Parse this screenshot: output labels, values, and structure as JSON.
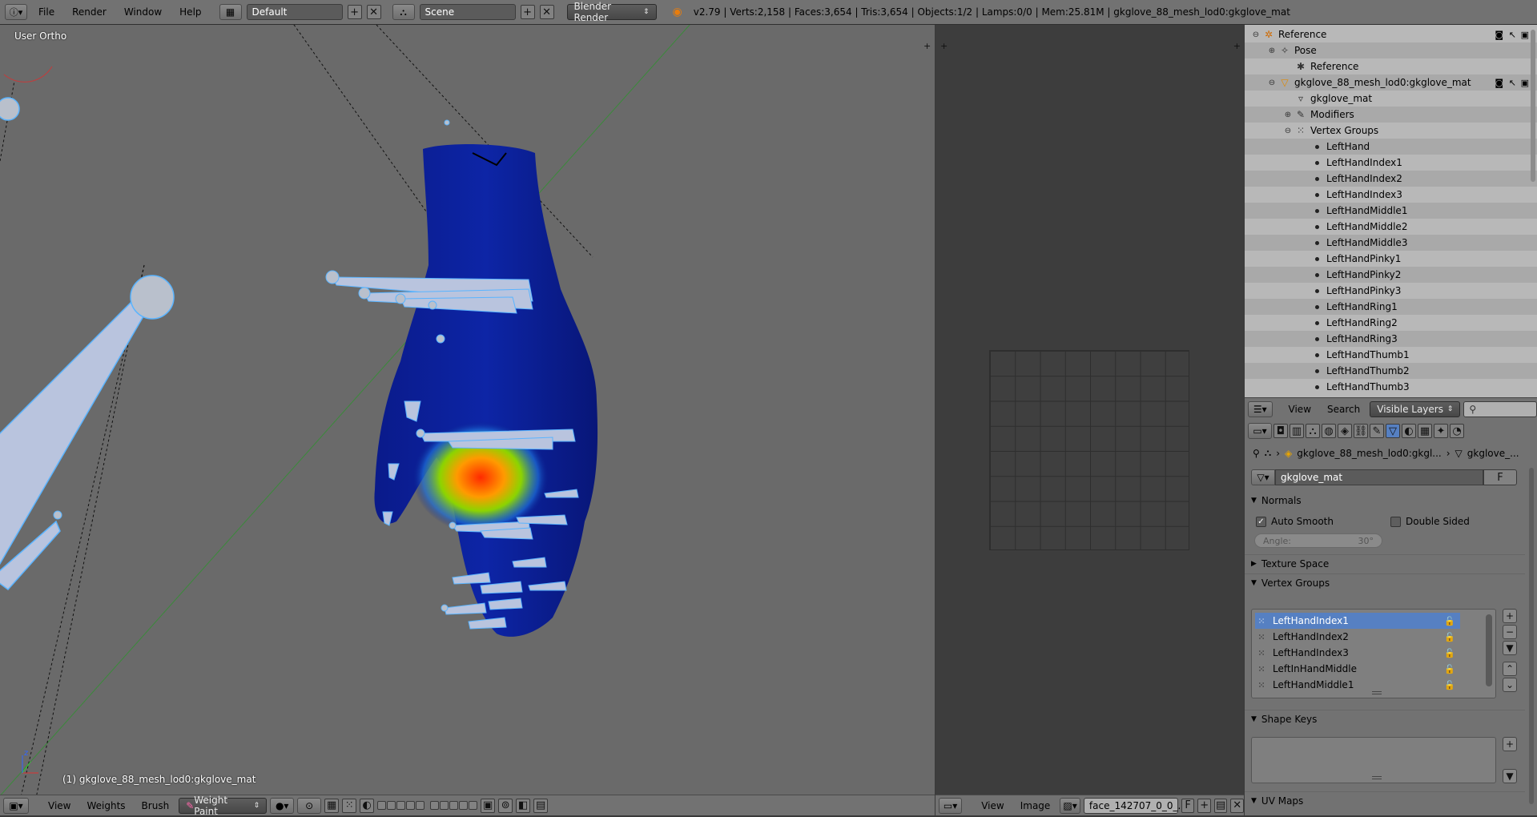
{
  "menubar": {
    "menus": [
      "File",
      "Render",
      "Window",
      "Help"
    ],
    "layout": "Default",
    "scene": "Scene",
    "engine": "Blender Render",
    "stats": "v2.79 | Verts:2,158 | Faces:3,654 | Tris:3,654 | Objects:1/2 | Lamps:0/0 | Mem:25.81M | gkglove_88_mesh_lod0:gkglove_mat"
  },
  "viewport": {
    "view_label": "User Ortho",
    "object_label": "(1) gkglove_88_mesh_lod0:gkglove_mat",
    "menus": [
      "View",
      "Weights",
      "Brush"
    ],
    "mode": "Weight Paint"
  },
  "image_editor": {
    "menus": [
      "View",
      "Image"
    ],
    "image_name": "face_142707_0_0_...",
    "fake_user": "F"
  },
  "outliner": {
    "rows": [
      {
        "label": "Reference",
        "indent": 0,
        "icon": "armature-icon"
      },
      {
        "label": "Pose",
        "indent": 1,
        "icon": "pose-icon"
      },
      {
        "label": "Reference",
        "indent": 2,
        "icon": "armature-data-icon"
      },
      {
        "label": "gkglove_88_mesh_lod0:gkglove_mat",
        "indent": 1,
        "icon": "mesh-icon"
      },
      {
        "label": "gkglove_mat",
        "indent": 2,
        "icon": "mesh-data-icon"
      },
      {
        "label": "Modifiers",
        "indent": 2,
        "icon": "wrench-icon"
      },
      {
        "label": "Vertex Groups",
        "indent": 2,
        "icon": "vertex-group-icon"
      },
      {
        "label": "LeftHand",
        "indent": 3,
        "icon": "dot-icon"
      },
      {
        "label": "LeftHandIndex1",
        "indent": 3,
        "icon": "dot-icon"
      },
      {
        "label": "LeftHandIndex2",
        "indent": 3,
        "icon": "dot-icon"
      },
      {
        "label": "LeftHandIndex3",
        "indent": 3,
        "icon": "dot-icon"
      },
      {
        "label": "LeftHandMiddle1",
        "indent": 3,
        "icon": "dot-icon"
      },
      {
        "label": "LeftHandMiddle2",
        "indent": 3,
        "icon": "dot-icon"
      },
      {
        "label": "LeftHandMiddle3",
        "indent": 3,
        "icon": "dot-icon"
      },
      {
        "label": "LeftHandPinky1",
        "indent": 3,
        "icon": "dot-icon"
      },
      {
        "label": "LeftHandPinky2",
        "indent": 3,
        "icon": "dot-icon"
      },
      {
        "label": "LeftHandPinky3",
        "indent": 3,
        "icon": "dot-icon"
      },
      {
        "label": "LeftHandRing1",
        "indent": 3,
        "icon": "dot-icon"
      },
      {
        "label": "LeftHandRing2",
        "indent": 3,
        "icon": "dot-icon"
      },
      {
        "label": "LeftHandRing3",
        "indent": 3,
        "icon": "dot-icon"
      },
      {
        "label": "LeftHandThumb1",
        "indent": 3,
        "icon": "dot-icon"
      },
      {
        "label": "LeftHandThumb2",
        "indent": 3,
        "icon": "dot-icon"
      },
      {
        "label": "LeftHandThumb3",
        "indent": 3,
        "icon": "dot-icon"
      }
    ],
    "footer": {
      "view": "View",
      "search": "Search",
      "filter": "Visible Layers"
    }
  },
  "properties": {
    "breadcrumb_object": "gkglove_88_mesh_lod0:gkgl...",
    "breadcrumb_data": "gkglove_...",
    "mesh_name": "gkglove_mat",
    "fake_user": "F",
    "normals": {
      "title": "Normals",
      "auto_smooth": "Auto Smooth",
      "double_sided": "Double Sided",
      "angle_label": "Angle:",
      "angle_value": "30°"
    },
    "texture_space": "Texture Space",
    "vertex_groups": {
      "title": "Vertex Groups",
      "items": [
        "LeftHandIndex1",
        "LeftHandIndex2",
        "LeftHandIndex3",
        "LeftInHandMiddle",
        "LeftHandMiddle1"
      ]
    },
    "shape_keys": "Shape Keys",
    "uv_maps": "UV Maps"
  },
  "colors": {
    "selection": "#5680c2",
    "mesh_blue": "#0a1f8c",
    "bone_outline": "#5ab4ff"
  }
}
